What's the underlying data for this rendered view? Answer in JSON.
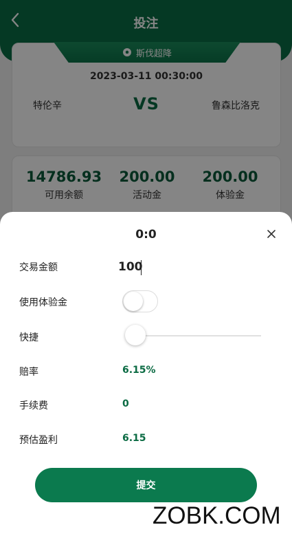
{
  "header": {
    "title": "投注"
  },
  "match": {
    "league": "斯伐超降",
    "time": "2023-03-11 00:30:00",
    "home_team": "特伦辛",
    "vs": "VS",
    "away_team": "鲁森比洛克"
  },
  "balances": [
    {
      "value": "14786.93",
      "label": "可用余额"
    },
    {
      "value": "200.00",
      "label": "活动金"
    },
    {
      "value": "200.00",
      "label": "体验金"
    }
  ],
  "sheet": {
    "title": "0:0",
    "amount_label": "交易金额",
    "amount_value": "100",
    "use_trial_label": "使用体验金",
    "use_trial_on": false,
    "quick_label": "快捷",
    "quick_level": 0,
    "odds_label": "赔率",
    "odds_value": "6.15%",
    "fee_label": "手续费",
    "fee_value": "0",
    "profit_label": "预估盈利",
    "profit_value": "6.15",
    "submit_label": "提交"
  },
  "watermark": "ZOBK.COM",
  "colors": {
    "brand": "#0b7a4e",
    "header": "#0a6e45",
    "value_text": "#0b6b43"
  },
  "icons": {
    "back": "chevron-left-icon",
    "league": "soccer-ball-icon",
    "close": "close-icon"
  }
}
